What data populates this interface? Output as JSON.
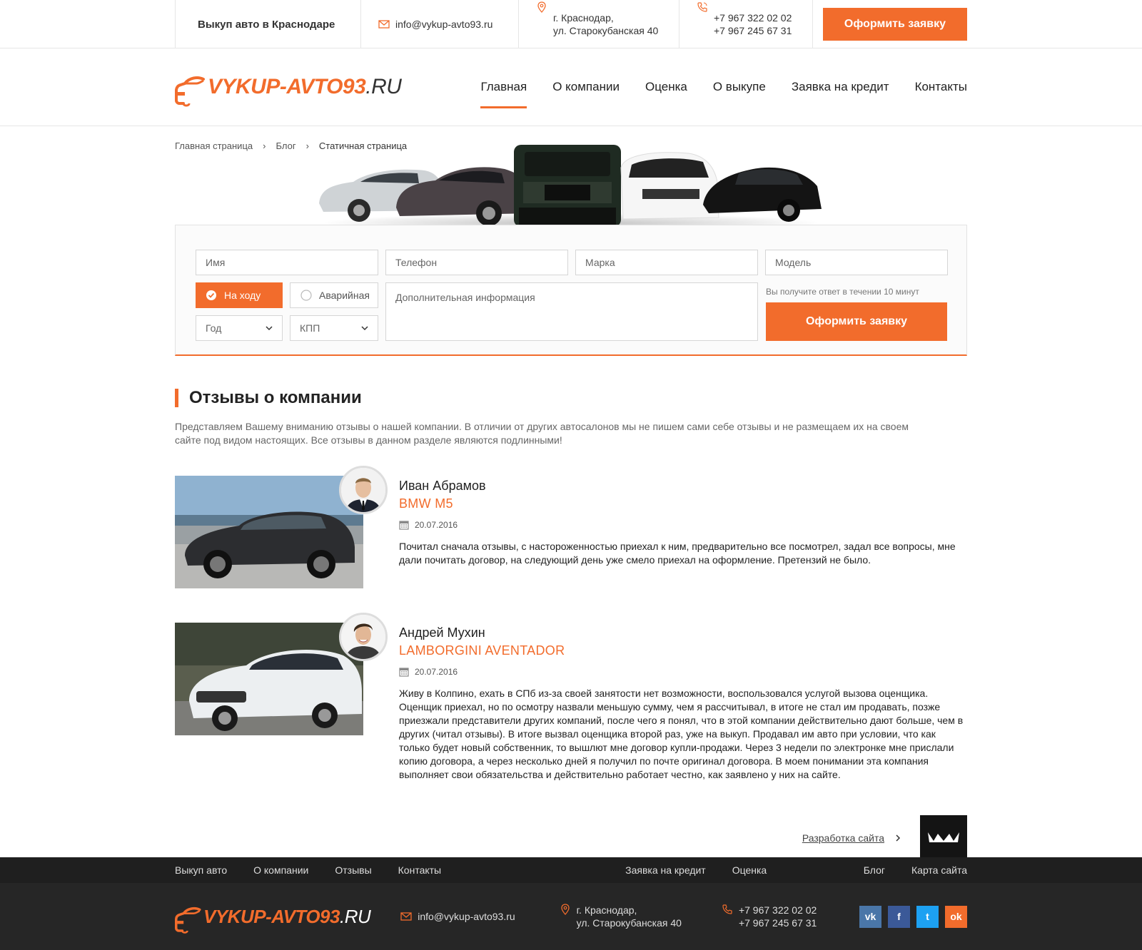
{
  "topbar": {
    "title": "Выкуп авто в Краснодаре",
    "email": "info@vykup-avto93.ru",
    "address_line1": "г. Краснодар,",
    "address_line2": "ул. Старокубанская 40",
    "phone1": "+7 967 322 02 02",
    "phone2": "+7 967 245 67 31",
    "cta_label": "Оформить заявку"
  },
  "logo": {
    "main": "VYKUP-AVTO93",
    "domain": ".RU"
  },
  "nav": {
    "items": [
      {
        "label": "Главная",
        "active": true
      },
      {
        "label": "О компании"
      },
      {
        "label": "Оценка"
      },
      {
        "label": "О выкупе"
      },
      {
        "label": "Заявка на кредит"
      },
      {
        "label": "Контакты"
      }
    ]
  },
  "breadcrumb": {
    "home": "Главная страница",
    "blog": "Блог",
    "current": "Статичная страница",
    "sep": "›"
  },
  "form": {
    "name_placeholder": "Имя",
    "phone_placeholder": "Телефон",
    "brand_placeholder": "Марка",
    "model_placeholder": "Модель",
    "state_on": "На ходу",
    "state_off": "Аварийная",
    "year_label": "Год",
    "gearbox_label": "КПП",
    "info_placeholder": "Дополнительная информация",
    "note": "Вы получите ответ в течении 10 минут",
    "submit_label": "Оформить заявку"
  },
  "reviews": {
    "title": "Отзывы о компании",
    "description": "Представляем Вашему вниманию отзывы о нашей компании. В отличии от других автосалонов мы не пишем сами себе отзывы и не размещаем их на своем сайте под видом настоящих. Все отзывы в данном разделе являются подлинными!",
    "items": [
      {
        "name": "Иван Абрамов",
        "car": "BMW M5",
        "date": "20.07.2016",
        "text": "Почитал сначала отзывы, с настороженностью приехал к ним, предварительно все посмотрел, задал все вопросы, мне дали почитать договор, на следующий день уже смело приехал на оформление. Претензий не было."
      },
      {
        "name": "Андрей Мухин",
        "car": "LAMBORGINI AVENTADOR",
        "date": "20.07.2016",
        "text": "Живу в Колпино, ехать в СПб из-за своей занятости нет возможности, воспользовался услугой вызова оценщика. Оценщик приехал, но по осмотру назвали меньшую сумму, чем я рассчитывал, в итоге не стал им продавать, позже приезжали представители других компаний, после чего я понял, что в этой компании действительно дают больше, чем в других (читал отзывы). В итоге вызвал оценщика второй раз, уже на выкуп. Продавал им авто при условии, что как только будет новый собственник, то вышлют мне договор купли-продажи. Через 3 недели по электронке мне прислали копию договора, а через несколько дней я получил по почте оригинал договора. В моем понимании эта компания выполняет свои обязательства и действительно работает честно, как заявлено у них на сайте."
      }
    ]
  },
  "dev": {
    "label": "Разработка сайта"
  },
  "footer_nav": {
    "left": [
      "Выкуп авто",
      "О компании",
      "Отзывы",
      "Контакты"
    ],
    "middle": [
      "Заявка на кредит",
      "Оценка"
    ],
    "right": [
      "Блог",
      "Карта сайта"
    ]
  },
  "footer": {
    "email": "info@vykup-avto93.ru",
    "address_line1": "г. Краснодар,",
    "address_line2": "ул. Старокубанская 40",
    "phone1": "+7 967 322 02 02",
    "phone2": "+7 967 245 67 31",
    "social": [
      {
        "name": "vk",
        "glyph": "vk",
        "color": "#4a76a8"
      },
      {
        "name": "facebook",
        "glyph": "f",
        "color": "#3b5998"
      },
      {
        "name": "twitter",
        "glyph": "t",
        "color": "#1da1f2"
      },
      {
        "name": "odnoklassniki",
        "glyph": "ok",
        "color": "#f26c2c"
      }
    ]
  },
  "colors": {
    "accent": "#f26c2c",
    "dark": "#1f1f1f"
  }
}
